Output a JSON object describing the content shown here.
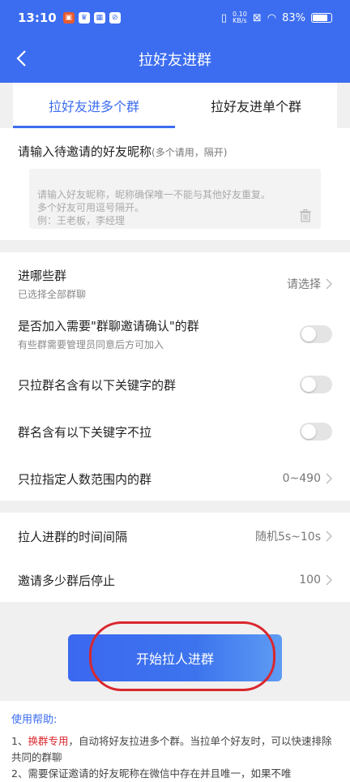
{
  "status_bar": {
    "time": "13:10",
    "net_speed_top": "0.10",
    "net_speed_bottom": "KB/s",
    "battery": "83%"
  },
  "nav": {
    "title": "拉好友进群"
  },
  "tabs": [
    {
      "label": "拉好友进多个群",
      "active": true
    },
    {
      "label": "拉好友进单个群",
      "active": false
    }
  ],
  "input_section": {
    "label": "请输入待邀请的好友昵称",
    "hint": "(多个请用，隔开)",
    "placeholder": "请输入好友昵称，昵称确保唯一不能与其他好友重复。\n多个好友可用逗号隔开。\n例：王老板，李经理"
  },
  "settings": {
    "groups": {
      "label": "进哪些群",
      "sub": "已选择全部群聊",
      "value": "请选择"
    },
    "confirm": {
      "label": "是否加入需要\"群聊邀请确认\"的群",
      "sub": "有些群需要管理员同意后方可加入"
    },
    "keyword_only": {
      "label": "只拉群名含有以下关键字的群"
    },
    "keyword_skip": {
      "label": "群名含有以下关键字不拉"
    },
    "member_range": {
      "label": "只拉指定人数范围内的群",
      "value": "0~490"
    }
  },
  "timing": {
    "interval": {
      "label": "拉人进群的时间间隔",
      "value": "随机5s~10s"
    },
    "stop_after": {
      "label": "邀请多少群后停止",
      "value": "100"
    }
  },
  "start_button": {
    "label": "开始拉人进群"
  },
  "help": {
    "title": "使用帮助:",
    "line1_prefix": "1、",
    "line1_highlight": "换群专用",
    "line1_rest": "，自动将好友拉进多个群。当拉单个好友时，可以快速排除共同的群聊",
    "line2": "2、需要保证邀请的好友昵称在微信中存在并且唯一，如果不唯"
  },
  "colors": {
    "primary": "#3c6df0",
    "highlight": "#d9272d",
    "background": "#f0f0f0"
  }
}
